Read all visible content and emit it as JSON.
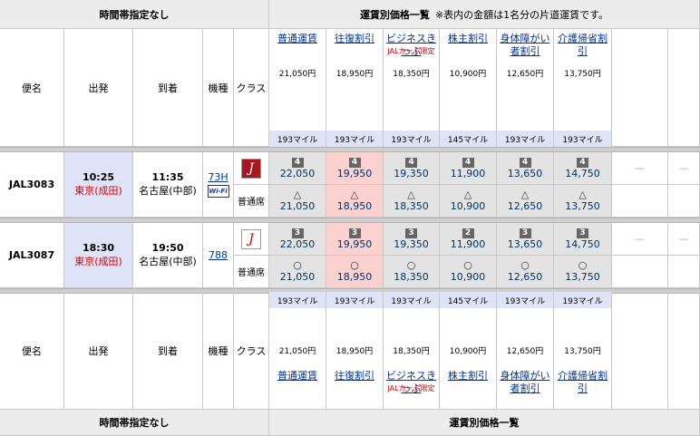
{
  "header": {
    "time_unspecified": "時間帯指定なし",
    "fare_list_title": "運賃別価格一覧",
    "fare_note": "※表内の金額は1名分の片道運賃です。"
  },
  "columns": {
    "flight": "便名",
    "departure": "出発",
    "arrival": "到着",
    "aircraft": "機種",
    "class": "クラス"
  },
  "fares": [
    {
      "name": "普通運賃",
      "note": "",
      "price": "21,050円",
      "miles": "193マイル"
    },
    {
      "name": "往復割引",
      "note": "",
      "price": "18,950円",
      "miles": "193マイル"
    },
    {
      "name": "ビジネスきっぷ",
      "note": "JALカード限定",
      "price": "18,350円",
      "miles": "193マイル"
    },
    {
      "name": "株主割引",
      "note": "",
      "price": "10,900円",
      "miles": "145マイル"
    },
    {
      "name": "身体障がい者割引",
      "note": "",
      "price": "12,650円",
      "miles": "193マイル"
    },
    {
      "name": "介護帰省割引",
      "note": "",
      "price": "13,750円",
      "miles": "193マイル"
    }
  ],
  "flights": [
    {
      "number": "JAL3083",
      "dep_time": "10:25",
      "dep_airport": "東京(成田)",
      "arr_time": "11:35",
      "arr_airport": "名古屋(中部)",
      "aircraft": "73H",
      "aircraft_badge": "Wi-Fi",
      "class_label": "普通席",
      "first": [
        {
          "seats": "4",
          "price": "22,050"
        },
        {
          "seats": "4",
          "price": "19,950"
        },
        {
          "seats": "4",
          "price": "19,350"
        },
        {
          "seats": "4",
          "price": "11,900"
        },
        {
          "seats": "4",
          "price": "13,650"
        },
        {
          "seats": "4",
          "price": "14,750"
        }
      ],
      "economy": [
        {
          "symbol": "△",
          "price": "21,050"
        },
        {
          "symbol": "△",
          "price": "18,950"
        },
        {
          "symbol": "△",
          "price": "18,350"
        },
        {
          "symbol": "△",
          "price": "10,900"
        },
        {
          "symbol": "△",
          "price": "12,650"
        },
        {
          "symbol": "△",
          "price": "13,750"
        }
      ],
      "extra": [
        "—",
        "—"
      ]
    },
    {
      "number": "JAL3087",
      "dep_time": "18:30",
      "dep_airport": "東京(成田)",
      "arr_time": "19:50",
      "arr_airport": "名古屋(中部)",
      "aircraft": "788",
      "class_label": "普通席",
      "first": [
        {
          "seats": "3",
          "price": "22,050"
        },
        {
          "seats": "3",
          "price": "19,950"
        },
        {
          "seats": "3",
          "price": "19,350"
        },
        {
          "seats": "2",
          "price": "11,900"
        },
        {
          "seats": "3",
          "price": "13,650"
        },
        {
          "seats": "3",
          "price": "14,750"
        }
      ],
      "economy": [
        {
          "symbol": "○",
          "price": "21,050"
        },
        {
          "symbol": "○",
          "price": "18,950"
        },
        {
          "symbol": "○",
          "price": "18,350"
        },
        {
          "symbol": "○",
          "price": "10,900"
        },
        {
          "symbol": "○",
          "price": "12,650"
        },
        {
          "symbol": "○",
          "price": "13,750"
        }
      ],
      "extra": [
        "—",
        "—"
      ]
    }
  ],
  "colors": {
    "pink": "#fcd2d0",
    "blue": "#dfe3f7",
    "gray": "#e3e3e3",
    "link": "#003399"
  }
}
